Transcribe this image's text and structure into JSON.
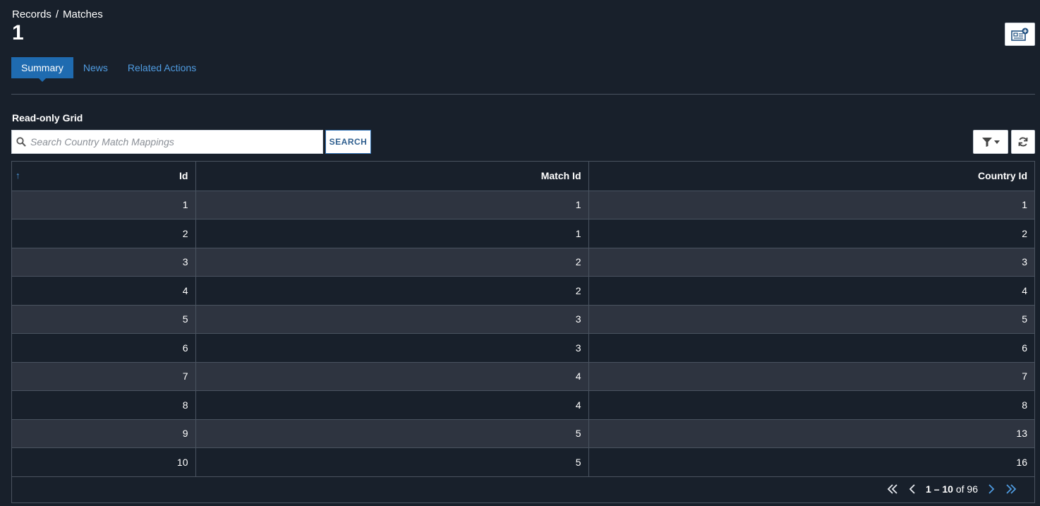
{
  "breadcrumb": {
    "parent": "Records",
    "separator": "/",
    "current": "Matches"
  },
  "page": {
    "title": "1"
  },
  "tabs": [
    {
      "label": "Summary",
      "active": true
    },
    {
      "label": "News",
      "active": false
    },
    {
      "label": "Related Actions",
      "active": false
    }
  ],
  "grid": {
    "label": "Read-only Grid",
    "search": {
      "placeholder": "Search Country Match Mappings",
      "value": "",
      "button_label": "SEARCH"
    },
    "columns": [
      "Id",
      "Match Id",
      "Country Id"
    ],
    "sort_column": "Id",
    "rows": [
      [
        "1",
        "1",
        "1"
      ],
      [
        "2",
        "1",
        "2"
      ],
      [
        "3",
        "2",
        "3"
      ],
      [
        "4",
        "2",
        "4"
      ],
      [
        "5",
        "3",
        "5"
      ],
      [
        "6",
        "3",
        "6"
      ],
      [
        "7",
        "4",
        "7"
      ],
      [
        "8",
        "4",
        "8"
      ],
      [
        "9",
        "5",
        "13"
      ],
      [
        "10",
        "5",
        "16"
      ]
    ],
    "pagination": {
      "range": "1 – 10",
      "of_label": "of",
      "total": "96"
    }
  },
  "colors": {
    "background": "#18202b",
    "accent": "#1f6bb0",
    "link": "#4f9be0"
  },
  "icons": [
    "news-add-icon",
    "search-icon",
    "filter-icon",
    "refresh-icon",
    "sort-asc-icon",
    "first-page-icon",
    "prev-page-icon",
    "next-page-icon",
    "last-page-icon"
  ]
}
